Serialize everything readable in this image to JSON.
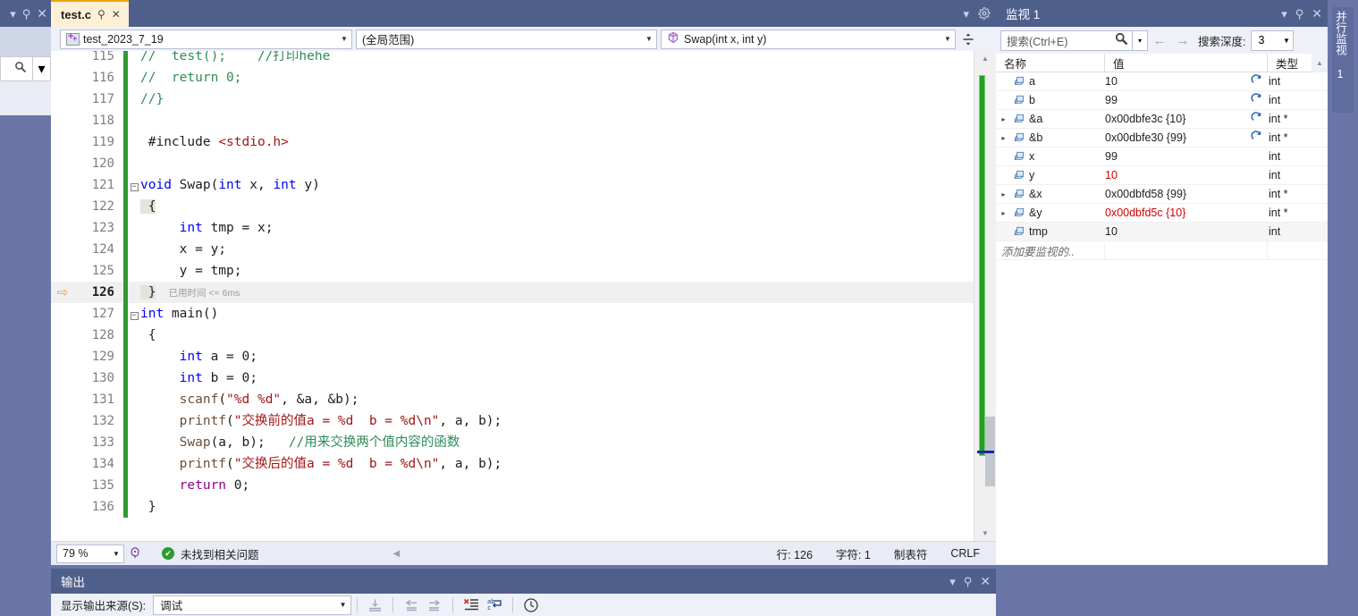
{
  "editor": {
    "tab": {
      "label": "test.c",
      "pin_icon": "pin-icon",
      "close_icon": "close-icon"
    },
    "nav": {
      "project": "test_2023_7_19",
      "scope": "(全局范围)",
      "function": "Swap(int x, int y)"
    },
    "code_lines": [
      {
        "no": "115",
        "indent": 0,
        "fold": "",
        "current": false,
        "tokens": [
          {
            "t": "//  test();    //打印hehe",
            "c": "k-cmt"
          }
        ]
      },
      {
        "no": "116",
        "indent": 0,
        "fold": "",
        "current": false,
        "tokens": [
          {
            "t": "//  return 0;",
            "c": "k-cmt"
          }
        ]
      },
      {
        "no": "117",
        "indent": 0,
        "fold": "",
        "current": false,
        "tokens": [
          {
            "t": "//}",
            "c": "k-cmt"
          }
        ]
      },
      {
        "no": "118",
        "indent": 0,
        "fold": "",
        "current": false,
        "tokens": []
      },
      {
        "no": "119",
        "indent": 0,
        "fold": "",
        "current": false,
        "tokens": [
          {
            "t": " #include ",
            "c": "k-pp"
          },
          {
            "t": "<stdio.h>",
            "c": "k-inc"
          }
        ]
      },
      {
        "no": "120",
        "indent": 0,
        "fold": "",
        "current": false,
        "tokens": []
      },
      {
        "no": "121",
        "indent": 0,
        "fold": "minus",
        "current": false,
        "tokens": [
          {
            "t": "void ",
            "c": "k-kw"
          },
          {
            "t": "Swap(",
            "c": "k-num"
          },
          {
            "t": "int",
            "c": "k-kw"
          },
          {
            "t": " x, ",
            "c": "k-num"
          },
          {
            "t": "int",
            "c": "k-kw"
          },
          {
            "t": " y)",
            "c": "k-num"
          }
        ]
      },
      {
        "no": "122",
        "indent": 0,
        "fold": "",
        "current": false,
        "tokens": [
          {
            "t": " {",
            "c": "brace-hl"
          }
        ]
      },
      {
        "no": "123",
        "indent": 0,
        "fold": "",
        "current": false,
        "tokens": [
          {
            "t": "     ",
            "c": "k-num"
          },
          {
            "t": "int",
            "c": "k-kw"
          },
          {
            "t": " tmp = x;",
            "c": "k-num"
          }
        ]
      },
      {
        "no": "124",
        "indent": 0,
        "fold": "",
        "current": false,
        "tokens": [
          {
            "t": "     x = y;",
            "c": "k-num"
          }
        ]
      },
      {
        "no": "125",
        "indent": 0,
        "fold": "",
        "current": false,
        "tokens": [
          {
            "t": "     y = tmp;",
            "c": "k-num"
          }
        ]
      },
      {
        "no": "126",
        "indent": 0,
        "fold": "",
        "current": true,
        "elapsed": "已用时间 <= 6ms",
        "tokens": [
          {
            "t": " }",
            "c": "brace-hl"
          }
        ]
      },
      {
        "no": "127",
        "indent": 0,
        "fold": "minus",
        "current": false,
        "tokens": [
          {
            "t": "int ",
            "c": "k-kw"
          },
          {
            "t": "main()",
            "c": "k-num"
          }
        ]
      },
      {
        "no": "128",
        "indent": 0,
        "fold": "",
        "current": false,
        "tokens": [
          {
            "t": " {",
            "c": "k-num"
          }
        ]
      },
      {
        "no": "129",
        "indent": 0,
        "fold": "",
        "current": false,
        "tokens": [
          {
            "t": "     ",
            "c": "k-num"
          },
          {
            "t": "int",
            "c": "k-kw"
          },
          {
            "t": " a = ",
            "c": "k-num"
          },
          {
            "t": "0",
            "c": "k-num"
          },
          {
            "t": ";",
            "c": "k-num"
          }
        ]
      },
      {
        "no": "130",
        "indent": 0,
        "fold": "",
        "current": false,
        "tokens": [
          {
            "t": "     ",
            "c": "k-num"
          },
          {
            "t": "int",
            "c": "k-kw"
          },
          {
            "t": " b = ",
            "c": "k-num"
          },
          {
            "t": "0",
            "c": "k-num"
          },
          {
            "t": ";",
            "c": "k-num"
          }
        ]
      },
      {
        "no": "131",
        "indent": 0,
        "fold": "",
        "current": false,
        "tokens": [
          {
            "t": "     ",
            "c": "k-num"
          },
          {
            "t": "scanf",
            "c": "k-fn"
          },
          {
            "t": "(",
            "c": "k-num"
          },
          {
            "t": "\"%d %d\"",
            "c": "k-str"
          },
          {
            "t": ", &a, &b);",
            "c": "k-num"
          }
        ]
      },
      {
        "no": "132",
        "indent": 0,
        "fold": "",
        "current": false,
        "tokens": [
          {
            "t": "     ",
            "c": "k-num"
          },
          {
            "t": "printf",
            "c": "k-fn"
          },
          {
            "t": "(",
            "c": "k-num"
          },
          {
            "t": "\"交换前的值a = %d  b = %d\\n\"",
            "c": "k-str"
          },
          {
            "t": ", a, b);",
            "c": "k-num"
          }
        ]
      },
      {
        "no": "133",
        "indent": 0,
        "fold": "",
        "current": false,
        "tokens": [
          {
            "t": "     ",
            "c": "k-num"
          },
          {
            "t": "Swap",
            "c": "k-fn"
          },
          {
            "t": "(a, b);   ",
            "c": "k-num"
          },
          {
            "t": "//用来交换两个值内容的函数",
            "c": "k-cmt"
          }
        ]
      },
      {
        "no": "134",
        "indent": 0,
        "fold": "",
        "current": false,
        "tokens": [
          {
            "t": "     ",
            "c": "k-num"
          },
          {
            "t": "printf",
            "c": "k-fn"
          },
          {
            "t": "(",
            "c": "k-num"
          },
          {
            "t": "\"交换后的值a = %d  b = %d\\n\"",
            "c": "k-str"
          },
          {
            "t": ", a, b);",
            "c": "k-num"
          }
        ]
      },
      {
        "no": "135",
        "indent": 0,
        "fold": "",
        "current": false,
        "tokens": [
          {
            "t": "     ",
            "c": "k-num"
          },
          {
            "t": "return",
            "c": "k-ret"
          },
          {
            "t": " ",
            "c": "k-num"
          },
          {
            "t": "0",
            "c": "k-num"
          },
          {
            "t": ";",
            "c": "k-num"
          }
        ]
      },
      {
        "no": "136",
        "indent": 0,
        "fold": "",
        "current": false,
        "tokens": [
          {
            "t": " }",
            "c": "k-num"
          }
        ]
      }
    ],
    "status": {
      "zoom": "79 %",
      "issues": "未找到相关问题",
      "line": "行: 126",
      "col": "字符: 1",
      "tabs": "制表符",
      "eol": "CRLF"
    }
  },
  "watch": {
    "title": "监视 1",
    "search_placeholder": "搜索(Ctrl+E)",
    "depth_label": "搜索深度:",
    "depth_value": "3",
    "columns": [
      "名称",
      "值",
      "类型"
    ],
    "add_row_placeholder": "添加要监视的..",
    "rows": [
      {
        "expand": false,
        "name": "a",
        "value": "10",
        "type": "int",
        "refresh": true,
        "changed": false,
        "value_changed": false
      },
      {
        "expand": false,
        "name": "b",
        "value": "99",
        "type": "int",
        "refresh": true,
        "changed": false,
        "value_changed": false
      },
      {
        "expand": true,
        "name": "&a",
        "value": "0x00dbfe3c {10}",
        "type": "int *",
        "refresh": true,
        "changed": false,
        "value_changed": false
      },
      {
        "expand": true,
        "name": "&b",
        "value": "0x00dbfe30 {99}",
        "type": "int *",
        "refresh": true,
        "changed": false,
        "value_changed": false
      },
      {
        "expand": false,
        "name": "x",
        "value": "99",
        "type": "int",
        "refresh": false,
        "changed": false,
        "value_changed": false
      },
      {
        "expand": false,
        "name": "y",
        "value": "10",
        "type": "int",
        "refresh": false,
        "changed": false,
        "value_changed": true
      },
      {
        "expand": true,
        "name": "&x",
        "value": "0x00dbfd58 {99}",
        "type": "int *",
        "refresh": false,
        "changed": false,
        "value_changed": false
      },
      {
        "expand": true,
        "name": "&y",
        "value": "0x00dbfd5c {10}",
        "type": "int *",
        "refresh": false,
        "changed": false,
        "value_changed": true
      },
      {
        "expand": false,
        "name": "tmp",
        "value": "10",
        "type": "int",
        "refresh": false,
        "changed": false,
        "value_changed": false,
        "shaded": true
      }
    ]
  },
  "side_tab": {
    "label": "并行监视 1"
  },
  "output": {
    "title": "输出",
    "source_label": "显示输出来源(S):",
    "source_value": "调试"
  },
  "colors": {
    "chrome": "#4f5f8c",
    "panel_bg": "#eef1f8",
    "tab_active": "#fdf0d5",
    "tab_accent": "#f0a30a",
    "changebar_green": "#2e9b2e",
    "exec_arrow": "#e8a33d",
    "changed_value": "#d00000"
  }
}
